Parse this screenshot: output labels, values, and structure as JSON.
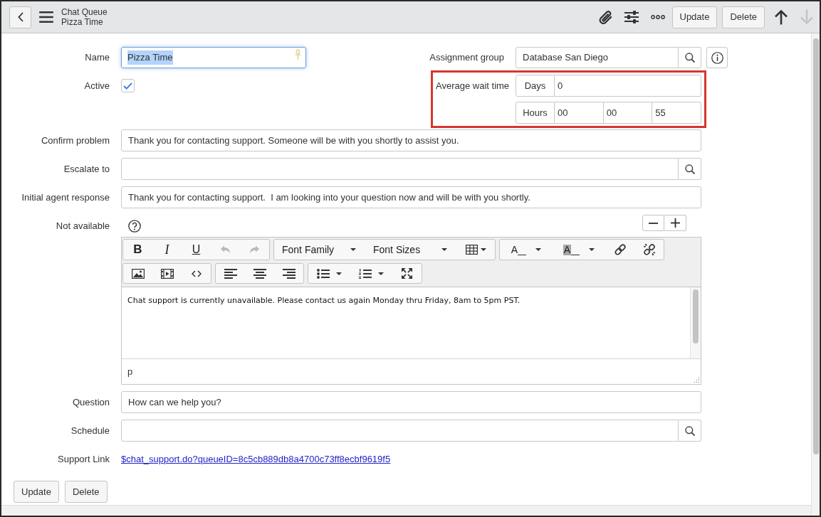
{
  "header": {
    "title": "Chat Queue",
    "subtitle": "Pizza Time",
    "buttons": [
      "Update",
      "Delete"
    ],
    "nav_arrows": [
      {
        "kind": "up",
        "disabled": false
      },
      {
        "kind": "down",
        "disabled": true
      }
    ]
  },
  "form": {
    "name": {
      "label": "Name",
      "value": "Pizza Time",
      "focused": true
    },
    "active": {
      "label": "Active",
      "checked": true
    },
    "assignment_group": {
      "label": "Assignment group",
      "value": "Database San Diego"
    },
    "average_wait_time": {
      "label": "Average wait time",
      "highlighted": true,
      "days_label": "Days",
      "days": "0",
      "time_label": "Hours",
      "time_values": [
        "00",
        "00",
        "55"
      ]
    },
    "fields": [
      {
        "kind": "text",
        "label": "Confirm problem",
        "value": "Thank you for contacting support. Someone will be with you shortly to assist you."
      },
      {
        "kind": "reference",
        "label": "Escalate to"
      },
      {
        "kind": "text",
        "label": "Initial agent response",
        "value": "Thank you for contacting support.  I am looking into your question now and will be with you shortly."
      },
      {
        "kind": "html",
        "label": "Not available",
        "editor": {
          "toolbar_rows": [
            {
              "groups": [
                {
                  "items": [
                    {
                      "kind": "bold",
                      "text": "B",
                      "disabled": false
                    },
                    {
                      "kind": "italic",
                      "text": "I",
                      "disabled": false
                    },
                    {
                      "kind": "underline",
                      "text": "U",
                      "disabled": false
                    },
                    {
                      "kind": "undo",
                      "disabled": true
                    },
                    {
                      "kind": "redo",
                      "disabled": true
                    }
                  ]
                },
                {
                  "items": [
                    {
                      "kind": "dropdown",
                      "text": "Font Family",
                      "disabled": false
                    },
                    {
                      "kind": "dropdown",
                      "text": "Font Sizes",
                      "disabled": false
                    },
                    {
                      "kind": "table",
                      "disabled": false
                    }
                  ]
                },
                {
                  "items": [
                    {
                      "kind": "text_color",
                      "text": "A",
                      "disabled": false
                    },
                    {
                      "kind": "highlight_color",
                      "text": "A",
                      "disabled": false
                    },
                    {
                      "kind": "link",
                      "disabled": false
                    },
                    {
                      "kind": "unlink",
                      "disabled": false
                    }
                  ]
                }
              ]
            },
            {
              "groups": [
                {
                  "items": [
                    {
                      "kind": "image",
                      "disabled": false
                    },
                    {
                      "kind": "media",
                      "disabled": false
                    },
                    {
                      "kind": "code",
                      "disabled": false
                    }
                  ]
                },
                {
                  "items": [
                    {
                      "kind": "align_left",
                      "disabled": false
                    },
                    {
                      "kind": "align_center",
                      "disabled": false
                    },
                    {
                      "kind": "align_right",
                      "disabled": false
                    }
                  ]
                },
                {
                  "items": [
                    {
                      "kind": "bullets",
                      "disabled": false
                    },
                    {
                      "kind": "numbering",
                      "disabled": false
                    },
                    {
                      "kind": "fullscreen",
                      "disabled": false
                    }
                  ]
                }
              ]
            }
          ],
          "content": "Chat support is currently unavailable. Please contact us again Monday thru Friday, 8am to 5pm PST.",
          "path": "p"
        }
      },
      {
        "kind": "text",
        "label": "Question",
        "value": "How can we help you?"
      },
      {
        "kind": "reference",
        "label": "Schedule"
      },
      {
        "kind": "link",
        "label": "Support Link",
        "value": "$chat_support.do?queueID=8c5cb889db8a4700c73ff8ecbf9619f5"
      }
    ],
    "buttons": [
      "Update",
      "Delete"
    ]
  }
}
